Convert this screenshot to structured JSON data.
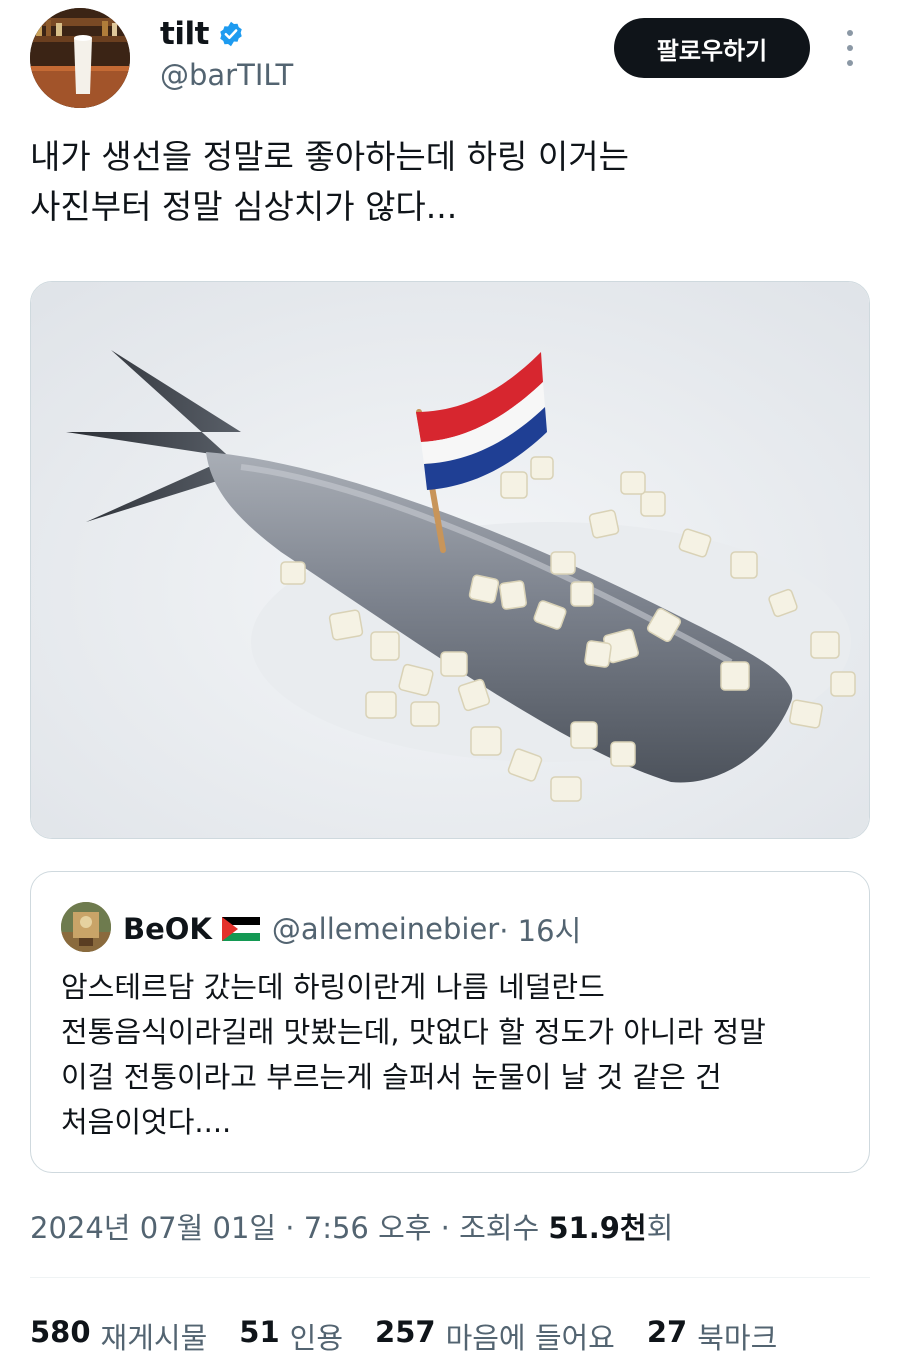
{
  "author": {
    "display_name": "tilt",
    "handle": "@barTILT",
    "verified": true,
    "avatar_icon": "avatar-bar-glass-icon"
  },
  "actions": {
    "follow_label": "팔로우하기",
    "more_icon": "more-vertical-icon"
  },
  "tweet": {
    "text_line1": "내가 생선을 정말로 좋아하는데 하링 이거는",
    "text_line2": "사진부터 정말 심상치가 않다..."
  },
  "media": {
    "description_icon": "herring-with-onions-and-dutch-flag-image"
  },
  "quote": {
    "display_name": "BeOK",
    "flag_icon": "palestine-flag-icon",
    "handle": "@allemeinebier",
    "time": " · 16시",
    "line1": "암스테르담 갔는데 하링이란게 나름 네덜란드",
    "line2": "전통음식이라길래 맛봤는데, 맛없다 할 정도가 아니라 정말",
    "line3": "이걸 전통이라고 부르는게 슬퍼서 눈물이 날 것 같은 건",
    "line4": "처음이엇다...."
  },
  "meta": {
    "date_time": "2024년 07월 01일 · 7:56 오후 · 조회수 ",
    "views_value": "51.9천",
    "views_suffix": "회"
  },
  "stats": [
    {
      "num": "580",
      "label": "재게시물"
    },
    {
      "num": "51",
      "label": "인용"
    },
    {
      "num": "257",
      "label": "마음에 들어요"
    },
    {
      "num": "27",
      "label": "북마크"
    }
  ],
  "colors": {
    "text_primary": "#0f1419",
    "text_secondary": "#536471",
    "verified_blue": "#1d9bf0",
    "border": "#cfd9de"
  }
}
